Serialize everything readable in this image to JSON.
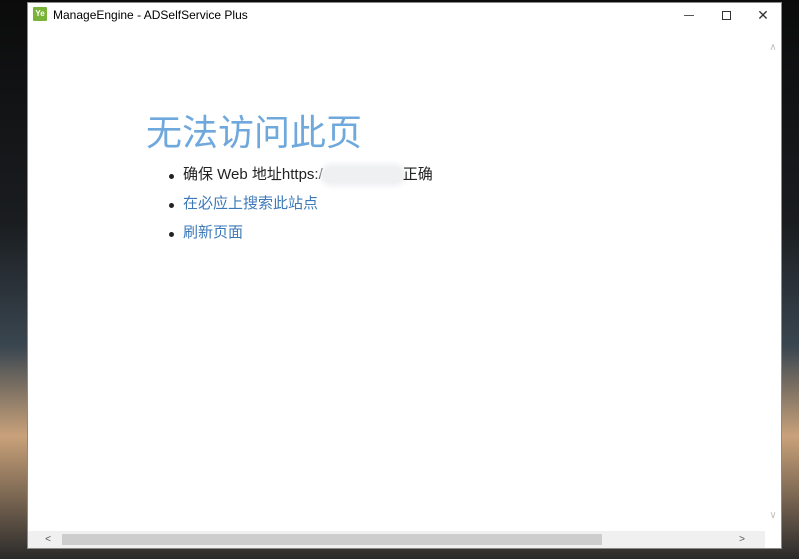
{
  "window": {
    "title": "ManageEngine - ADSelfService Plus",
    "app_icon_text": "Ye"
  },
  "controls": {
    "minimize": "minimize-icon",
    "maximize": "maximize-icon",
    "close": "close-icon",
    "close_glyph": "✕"
  },
  "page": {
    "heading": "无法访问此页",
    "items": [
      {
        "prefix": "确保 Web 地址https:/",
        "suffix": "正确"
      },
      {
        "label": "在必应上搜索此站点"
      },
      {
        "label": "刷新页面"
      }
    ]
  },
  "scrollbar": {
    "up": "chevron-up-icon",
    "down": "chevron-down-icon",
    "left": "chevron-left-icon",
    "right": "chevron-right-icon",
    "up_glyph": "∧",
    "down_glyph": "∨",
    "left_glyph": "<",
    "right_glyph": ">"
  }
}
